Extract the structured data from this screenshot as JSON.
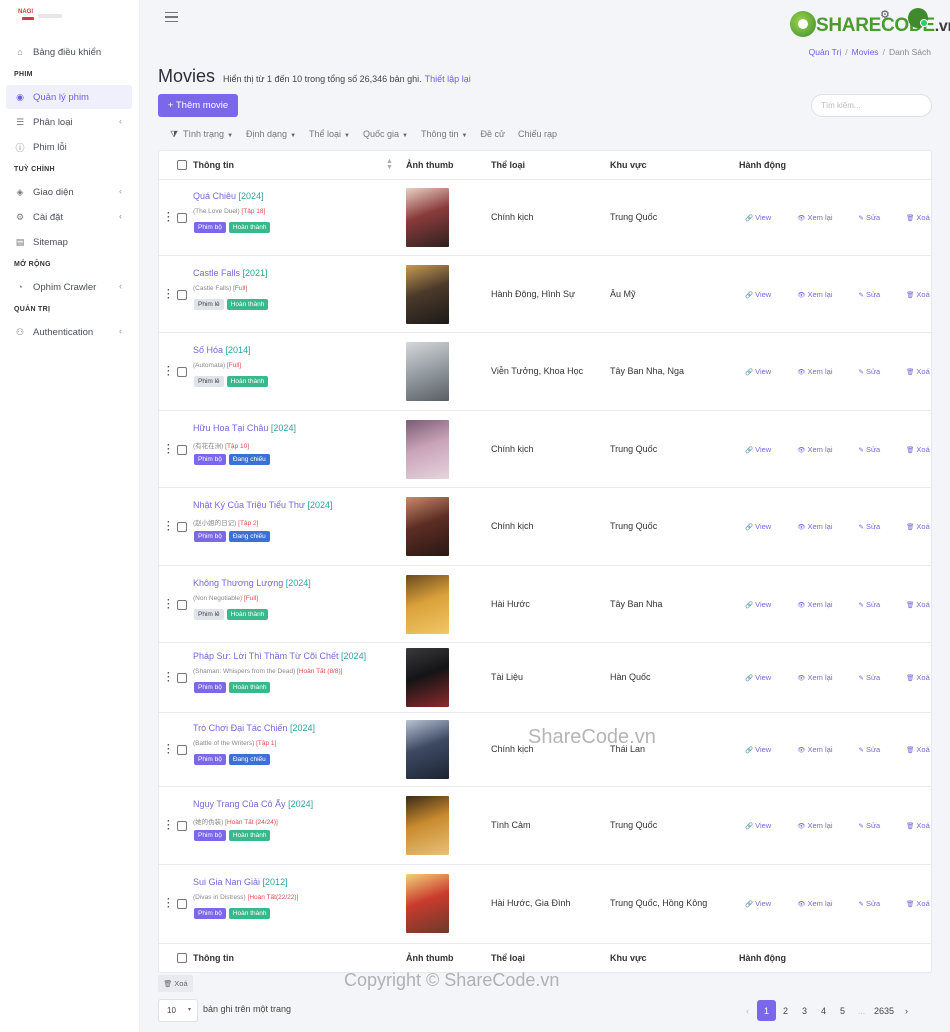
{
  "sidebar": {
    "items": [
      {
        "label": "Bảng điều khiển",
        "icon": "home-icon",
        "symbol": "⌂",
        "chev": ""
      },
      {
        "section": "PHIM"
      },
      {
        "label": "Quản lý phim",
        "icon": "film-icon",
        "symbol": "◉",
        "chev": "",
        "active": true
      },
      {
        "label": "Phân loại",
        "icon": "list-icon",
        "symbol": "☰",
        "chev": "‹"
      },
      {
        "label": "Phim lỗi",
        "icon": "info-icon",
        "symbol": "ⓘ",
        "chev": ""
      },
      {
        "section": "TUỲ CHỈNH"
      },
      {
        "label": "Giao diện",
        "icon": "palette-icon",
        "symbol": "◈",
        "chev": "‹"
      },
      {
        "label": "Cài đặt",
        "icon": "gear-icon",
        "symbol": "⚙",
        "chev": "‹"
      },
      {
        "label": "Sitemap",
        "icon": "map-icon",
        "symbol": "▤",
        "chev": ""
      },
      {
        "section": "MỞ RỘNG"
      },
      {
        "label": "Ophim Crawler",
        "icon": "crawler-icon",
        "symbol": "◔",
        "chev": "‹"
      },
      {
        "section": "QUẢN TRỊ"
      },
      {
        "label": "Authentication",
        "icon": "users-icon",
        "symbol": "⚇",
        "chev": "‹"
      }
    ]
  },
  "logo": {
    "text": "NAGI"
  },
  "brand": {
    "name": "SHARECODE",
    "suffix": ".vn"
  },
  "breadcrumb": {
    "items": [
      "Quản Trị",
      "Movies",
      "Danh Sách"
    ]
  },
  "page": {
    "title": "Movies",
    "subtitle": "Hiển thị từ 1 đến 10 trong tổng số 26,346 bản ghi.",
    "reset": "Thiết lập lại",
    "add_button": "+ Thêm movie",
    "search_placeholder": "Tìm kiếm..."
  },
  "filters": [
    "Tình trạng",
    "Định dạng",
    "Thể loại",
    "Quốc gia",
    "Thông tin",
    "Đề cử",
    "Chiếu rạp"
  ],
  "table": {
    "headers": {
      "info": "Thông tin",
      "thumb": "Ảnh thumb",
      "genre": "Thể loại",
      "region": "Khu vực",
      "actions": "Hành động"
    },
    "actions": {
      "view": "View",
      "preview": "Xem lại",
      "edit": "Sửa",
      "delete": "Xoá"
    },
    "rows": [
      {
        "name": "Quá Chiêu",
        "year": "[2024]",
        "original": "(The Love Duel)",
        "episode": "[Tập 18]",
        "type": "Phim bộ",
        "status": "Hoàn thành",
        "genre": "Chính kịch",
        "region": "Trung Quốc",
        "thumb_colors": [
          "#8a3b3b",
          "#e9d1c3",
          "#2d2220"
        ]
      },
      {
        "name": "Castle Falls",
        "year": "[2021]",
        "original": "(Castle Falls)",
        "episode": "[Full]",
        "type": "Phim lẻ",
        "status": "Hoàn thành",
        "genre": "Hành Động, Hình Sự",
        "region": "Âu Mỹ",
        "thumb_colors": [
          "#4b3a2a",
          "#c89a55",
          "#1c1a18"
        ]
      },
      {
        "name": "Số Hóa",
        "year": "[2014]",
        "original": "(Automata)",
        "episode": "[Full]",
        "type": "Phim lẻ",
        "status": "Hoàn thành",
        "genre": "Viễn Tưởng, Khoa Học",
        "region": "Tây Ban Nha, Nga",
        "thumb_colors": [
          "#9aa1a8",
          "#d5d8da",
          "#585e63"
        ]
      },
      {
        "name": "Hữu Hoa Tại Châu",
        "year": "[2024]",
        "original": "(有花在洲)",
        "episode": "[Tập 10]",
        "type": "Phim bộ",
        "status": "Đang chiếu",
        "genre": "Chính kịch",
        "region": "Trung Quốc",
        "thumb_colors": [
          "#c9a3b8",
          "#7a5c74",
          "#e6d4dd"
        ]
      },
      {
        "name": "Nhật Ký Của Triệu Tiểu Thư",
        "year": "[2024]",
        "original": "(赵小姐的日记)",
        "episode": "[Tập 2]",
        "type": "Phim bộ",
        "status": "Đang chiếu",
        "genre": "Chính kịch",
        "region": "Trung Quốc",
        "thumb_colors": [
          "#5c2e24",
          "#c98a6a",
          "#2a1713"
        ]
      },
      {
        "name": "Không Thương Lượng",
        "year": "[2024]",
        "original": "(Non Negotiable)",
        "episode": "[Full]",
        "type": "Phim lẻ",
        "status": "Hoàn thành",
        "genre": "Hài Hước",
        "region": "Tây Ban Nha",
        "thumb_colors": [
          "#d9a13a",
          "#6b4a1f",
          "#f2c766"
        ]
      },
      {
        "name": "Pháp Sư: Lời Thì Thầm Từ Cõi Chết",
        "year": "[2024]",
        "original": "(Shaman: Whispers from the Dead)",
        "episode": "[Hoàn Tất (8/8)]",
        "type": "Phim bộ",
        "status": "Hoàn thành",
        "genre": "Tài Liệu",
        "region": "Hàn Quốc",
        "thumb_colors": [
          "#141416",
          "#3a3a3e",
          "#8c2a2a"
        ]
      },
      {
        "name": "Trò Chơi Đại Tác Chiến",
        "year": "[2024]",
        "original": "(Battle of the Writers)",
        "episode": "[Tập 1]",
        "type": "Phim bộ",
        "status": "Đang chiếu",
        "genre": "Chính kịch",
        "region": "Thái Lan",
        "thumb_colors": [
          "#3d4a63",
          "#b8c2d4",
          "#1d2433"
        ]
      },
      {
        "name": "Ngụy Trang Của Cô Ấy",
        "year": "[2024]",
        "original": "(她的伪装)",
        "episode": "[Hoàn Tất (24/24)]",
        "type": "Phim bộ",
        "status": "Hoàn thành",
        "genre": "Tình Cảm",
        "region": "Trung Quốc",
        "thumb_colors": [
          "#c98b2e",
          "#3b2a18",
          "#e8c277"
        ]
      },
      {
        "name": "Sui Gia Nan Giải",
        "year": "[2012]",
        "original": "(Divas in Distress)",
        "episode": "[Hoàn Tất(22/22)]",
        "type": "Phim bộ",
        "status": "Hoàn thành",
        "genre": "Hài Hước, Gia Đình",
        "region": "Trung Quốc, Hồng Kông",
        "thumb_colors": [
          "#c93b2e",
          "#f2d27a",
          "#6b3a2a"
        ]
      }
    ]
  },
  "bulk_delete": "Xoá",
  "per_page": {
    "value": "10",
    "label": "bản ghi trên một trang"
  },
  "pagination": {
    "prev": "‹",
    "pages": [
      "1",
      "2",
      "3",
      "4",
      "5"
    ],
    "ellipsis": "...",
    "last": "2635",
    "next": "›",
    "current": "1"
  },
  "watermarks": {
    "center": "ShareCode.vn",
    "bottom": "Copyright © ShareCode.vn"
  }
}
